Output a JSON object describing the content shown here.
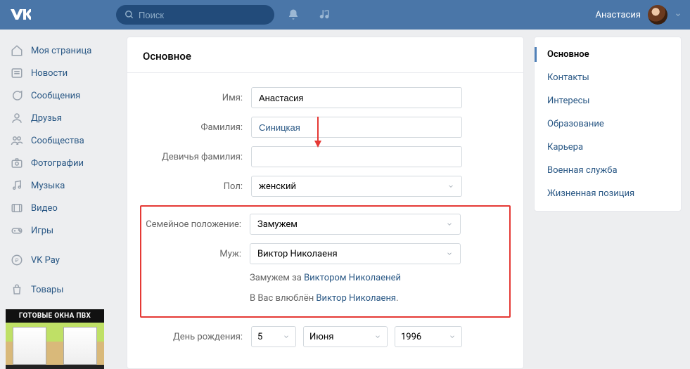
{
  "header": {
    "search_placeholder": "Поиск",
    "username": "Анастасия"
  },
  "left_nav": [
    {
      "icon": "home",
      "label": "Моя страница"
    },
    {
      "icon": "news",
      "label": "Новости"
    },
    {
      "icon": "msg",
      "label": "Сообщения"
    },
    {
      "icon": "friends",
      "label": "Друзья"
    },
    {
      "icon": "groups",
      "label": "Сообщества"
    },
    {
      "icon": "photos",
      "label": "Фотографии"
    },
    {
      "icon": "music",
      "label": "Музыка"
    },
    {
      "icon": "video",
      "label": "Видео"
    },
    {
      "icon": "games",
      "label": "Игры"
    },
    {
      "sep": true
    },
    {
      "icon": "pay",
      "label": "VK Pay"
    },
    {
      "sep": true
    },
    {
      "icon": "market",
      "label": "Товары"
    }
  ],
  "ad": {
    "title": "ГОТОВЫЕ ОКНА ПВХ"
  },
  "main": {
    "title": "Основное",
    "fields": {
      "name_label": "Имя:",
      "name_value": "Анастасия",
      "surname_label": "Фамилия:",
      "surname_value": "Синицкая",
      "maiden_label": "Девичья фамилия:",
      "maiden_value": "",
      "sex_label": "Пол:",
      "sex_value": "женский",
      "marital_label": "Семейное положение:",
      "marital_value": "Замужем",
      "spouse_label": "Муж:",
      "spouse_value": "Виктор Николаеня",
      "married_to_prefix": "Замужем за ",
      "married_to_link": "Виктором Николаеней",
      "inlove_prefix": "В Вас влюблён ",
      "inlove_link": "Виктор Николаеня",
      "inlove_suffix": ".",
      "dob_label": "День рождения:",
      "dob_day": "5",
      "dob_month": "Июня",
      "dob_year": "1996"
    }
  },
  "tabs": [
    "Основное",
    "Контакты",
    "Интересы",
    "Образование",
    "Карьера",
    "Военная служба",
    "Жизненная позиция"
  ]
}
